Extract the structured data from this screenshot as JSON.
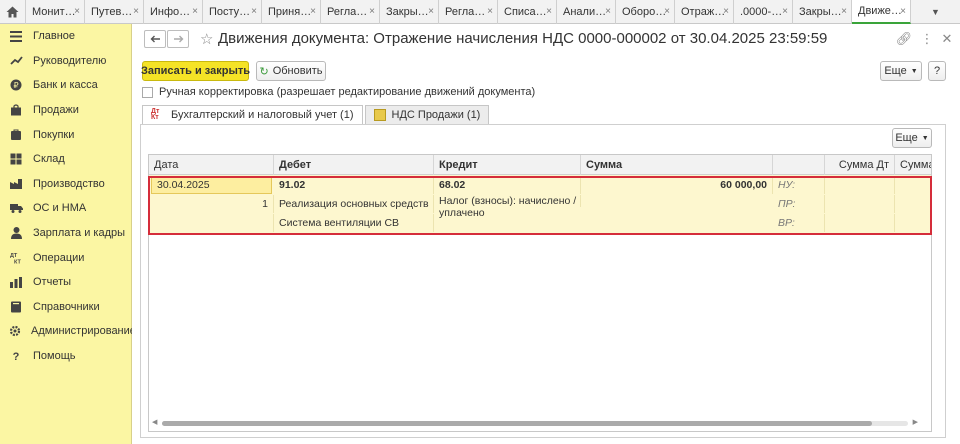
{
  "tabs": [
    {
      "label": "Монит…"
    },
    {
      "label": "Путев…"
    },
    {
      "label": "Инфо…"
    },
    {
      "label": "Посту…"
    },
    {
      "label": "Приня…"
    },
    {
      "label": "Регла…"
    },
    {
      "label": "Закры…"
    },
    {
      "label": "Регла…"
    },
    {
      "label": "Списа…"
    },
    {
      "label": "Анали…"
    },
    {
      "label": "Оборо…"
    },
    {
      "label": "Отраж…"
    },
    {
      "label": ".0000-…"
    },
    {
      "label": "Закры…"
    },
    {
      "label": "Движе…"
    }
  ],
  "sidebar": {
    "items": [
      {
        "label": "Главное",
        "icon": "menu-icon"
      },
      {
        "label": "Руководителю",
        "icon": "trend-icon"
      },
      {
        "label": "Банк и касса",
        "icon": "coins-icon"
      },
      {
        "label": "Продажи",
        "icon": "bag-icon"
      },
      {
        "label": "Покупки",
        "icon": "cart-icon"
      },
      {
        "label": "Склад",
        "icon": "warehouse-icon"
      },
      {
        "label": "Производство",
        "icon": "factory-icon"
      },
      {
        "label": "ОС и НМА",
        "icon": "truck-icon"
      },
      {
        "label": "Зарплата и кадры",
        "icon": "person-icon"
      },
      {
        "label": "Операции",
        "icon": "dtkt-icon"
      },
      {
        "label": "Отчеты",
        "icon": "chart-icon"
      },
      {
        "label": "Справочники",
        "icon": "book-icon"
      },
      {
        "label": "Администрирование",
        "icon": "gear-icon"
      },
      {
        "label": "Помощь",
        "icon": "question-icon"
      }
    ]
  },
  "header": {
    "title": "Движения документа: Отражение начисления НДС 0000-000002 от 30.04.2025 23:59:59"
  },
  "toolbar": {
    "save_close": "Записать и закрыть",
    "refresh": "Обновить",
    "more": "Еще",
    "help": "?"
  },
  "checkbox_label": "Ручная корректировка (разрешает редактирование движений документа)",
  "inner_tabs": [
    {
      "label": "Бухгалтерский и налоговый учет (1)",
      "icon_text": "Дт Кт"
    },
    {
      "label": "НДС Продажи (1)"
    }
  ],
  "grid": {
    "more": "Еще",
    "columns": [
      "Дата",
      "Дебет",
      "Кредит",
      "Сумма",
      "",
      "Сумма Дт",
      "Сумма К"
    ],
    "row": {
      "date": "30.04.2025",
      "num": "1",
      "debit_account": "91.02",
      "debit_sub1": "Реализация основных средств",
      "debit_sub2": "Система вентиляции СВ",
      "credit_account": "68.02",
      "credit_sub1": "Налог (взносы): начислено /",
      "credit_sub1b": "уплачено",
      "amount": "60 000,00",
      "nu": "НУ:",
      "pr": "ПР:",
      "vr": "ВР:"
    }
  },
  "colors": {
    "sidebar_bg": "#fbf6a3",
    "primary_btn": "#f5e326",
    "highlight": "#d52d3a",
    "active_tab": "#3aa43a"
  }
}
